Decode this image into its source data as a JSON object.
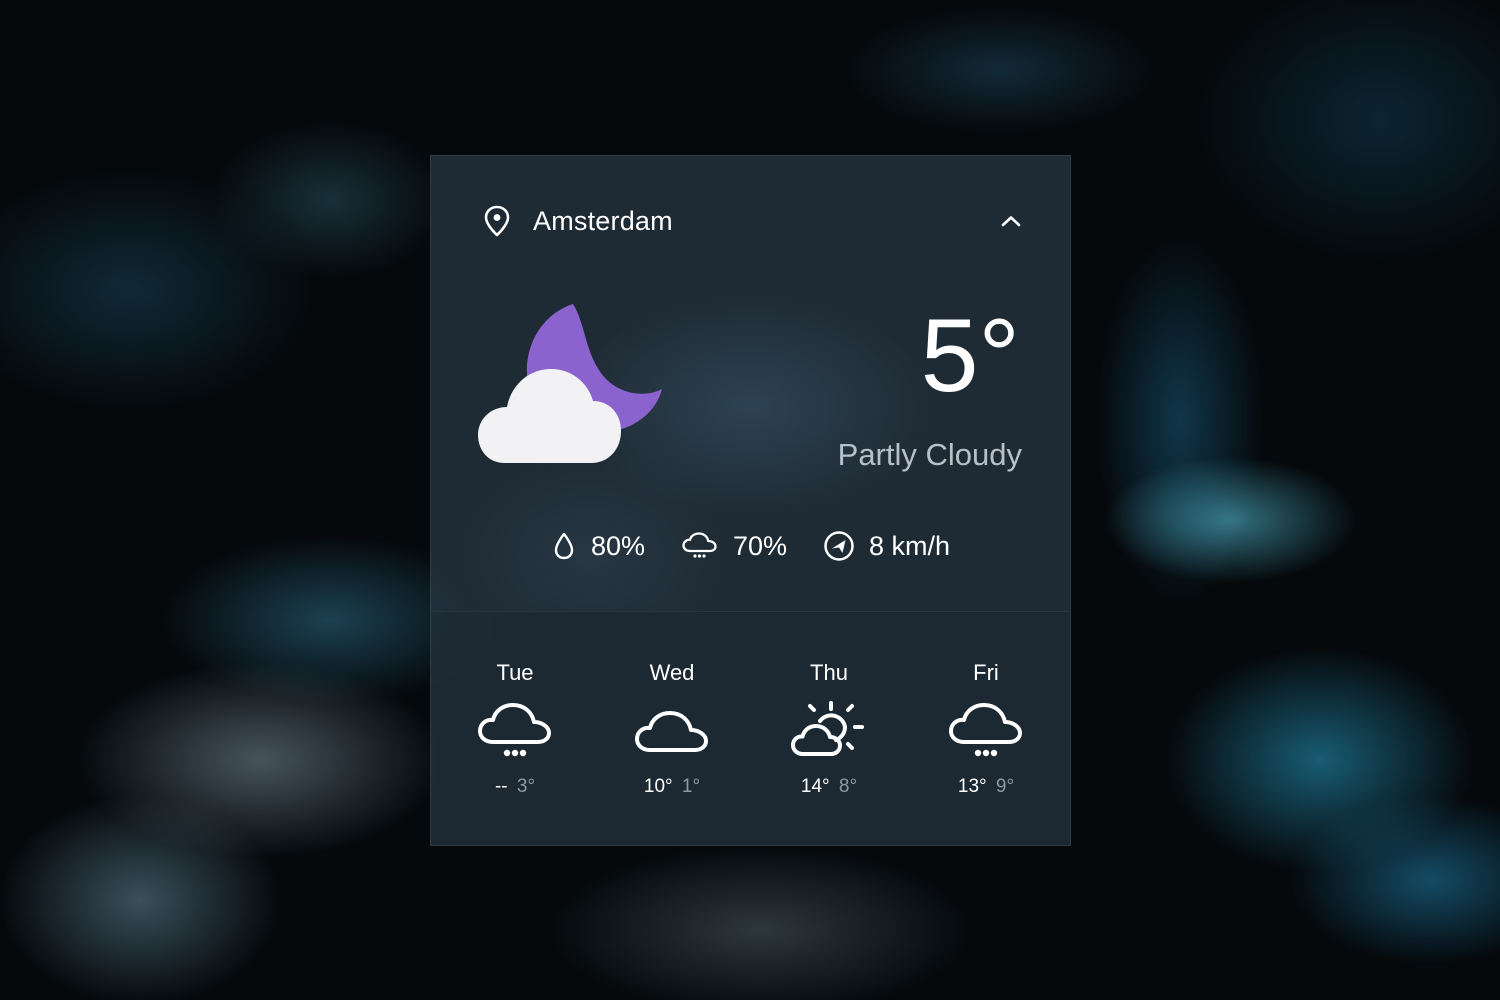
{
  "location": {
    "city": "Amsterdam"
  },
  "current": {
    "temperature": "5°",
    "condition": "Partly Cloudy",
    "icon": "moon-cloud-icon",
    "colors": {
      "moon": "#8a63cf",
      "cloud": "#f2f2f4"
    }
  },
  "stats": [
    {
      "icon": "humidity-drop-icon",
      "value": "80%"
    },
    {
      "icon": "rain-chance-icon",
      "value": "70%"
    },
    {
      "icon": "wind-direction-icon",
      "value": "8 km/h"
    }
  ],
  "forecast": [
    {
      "day": "Tue",
      "icon": "rain-cloud-icon",
      "high": "--",
      "low": "3°"
    },
    {
      "day": "Wed",
      "icon": "cloud-icon",
      "high": "10°",
      "low": "1°"
    },
    {
      "day": "Thu",
      "icon": "partly-sunny-icon",
      "high": "14°",
      "low": "8°"
    },
    {
      "day": "Fri",
      "icon": "rain-cloud-icon",
      "high": "13°",
      "low": "9°"
    }
  ]
}
